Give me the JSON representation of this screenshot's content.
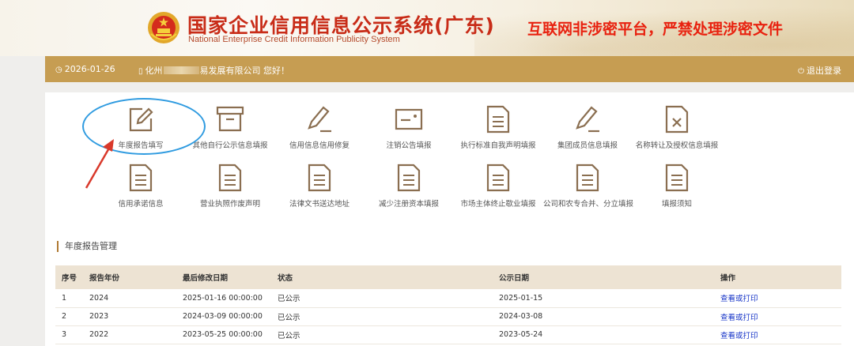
{
  "header": {
    "title_cn": "国家企业信用信息公示系统(广东)",
    "title_en": "National Enterprise Credit Information Publicity System",
    "warning": "互联网非涉密平台，严禁处理涉密文件"
  },
  "topbar": {
    "date": "2026-01-26",
    "user_prefix": "化州",
    "user_suffix": "易发展有限公司 您好！",
    "logout": "退出登录"
  },
  "functions": [
    {
      "label": "年度报告填写",
      "icon": "edit-icon"
    },
    {
      "label": "其他自行公示信息填报",
      "icon": "archive-box-icon"
    },
    {
      "label": "信用信息信用修复",
      "icon": "pen-icon"
    },
    {
      "label": "注销公告填报",
      "icon": "card-icon"
    },
    {
      "label": "执行标准自我声明填报",
      "icon": "document-icon"
    },
    {
      "label": "集团成员信息填报",
      "icon": "pen-icon"
    },
    {
      "label": "名称转让及授权信息填报",
      "icon": "document-x-icon"
    },
    {
      "label": "信用承诺信息",
      "icon": "document-icon"
    },
    {
      "label": "营业执照作废声明",
      "icon": "document-icon"
    },
    {
      "label": "法律文书送达地址",
      "icon": "document-icon"
    },
    {
      "label": "减少注册资本填报",
      "icon": "document-icon"
    },
    {
      "label": "市场主体终止歇业填报",
      "icon": "document-icon"
    },
    {
      "label": "公司和农专合并、分立填报",
      "icon": "document-icon"
    },
    {
      "label": "填报须知",
      "icon": "document-icon"
    }
  ],
  "section": {
    "title": "年度报告管理"
  },
  "table": {
    "headers": [
      "序号",
      "报告年份",
      "最后修改日期",
      "状态",
      "公示日期",
      "操作"
    ],
    "rows": [
      [
        "1",
        "2024",
        "2025-01-16 00:00:00",
        "已公示",
        "2025-01-15",
        "查看或打印"
      ],
      [
        "2",
        "2023",
        "2024-03-09 00:00:00",
        "已公示",
        "2024-03-08",
        "查看或打印"
      ],
      [
        "3",
        "2022",
        "2023-05-25 00:00:00",
        "已公示",
        "2023-05-24",
        "查看或打印"
      ]
    ]
  },
  "colors": {
    "brand_red": "#c82c18",
    "gold": "#c69d52",
    "icon": "#8a6e50",
    "annotation_blue": "#2f9be0",
    "annotation_red": "#d9392b",
    "link": "#1a37c8"
  }
}
